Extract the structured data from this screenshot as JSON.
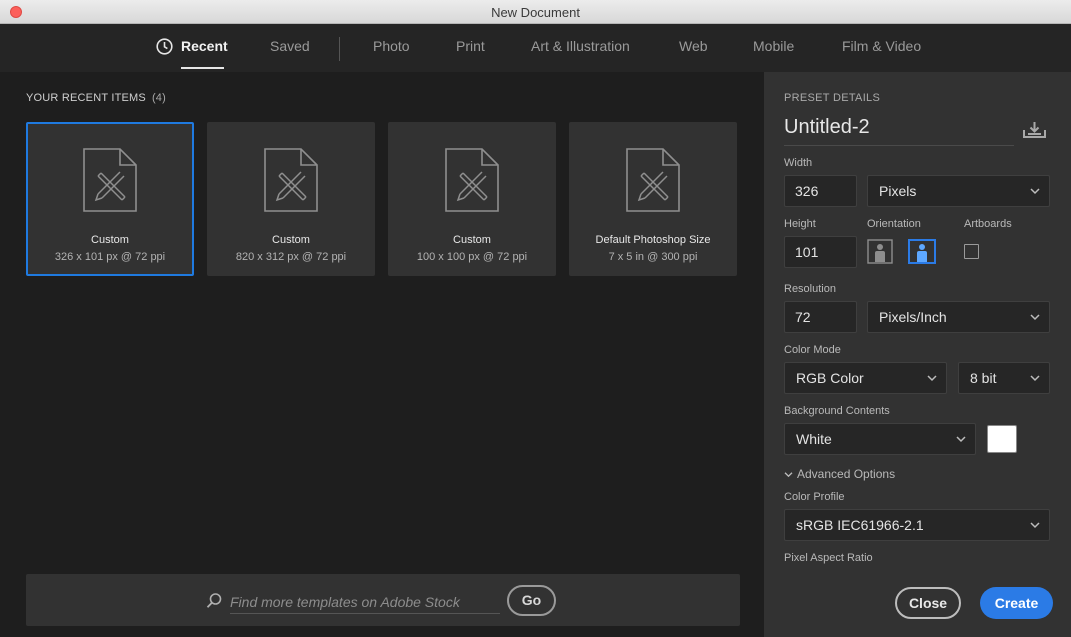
{
  "window": {
    "title": "New Document"
  },
  "tabs": [
    {
      "label": "Recent",
      "active": true
    },
    {
      "label": "Saved"
    },
    {
      "label": "Photo"
    },
    {
      "label": "Print"
    },
    {
      "label": "Art & Illustration"
    },
    {
      "label": "Web"
    },
    {
      "label": "Mobile"
    },
    {
      "label": "Film & Video"
    }
  ],
  "recent": {
    "heading": "YOUR RECENT ITEMS",
    "count": "(4)",
    "items": [
      {
        "name": "Custom",
        "dims": "326 x 101 px @ 72 ppi",
        "selected": true
      },
      {
        "name": "Custom",
        "dims": "820 x 312 px @ 72 ppi"
      },
      {
        "name": "Custom",
        "dims": "100 x 100 px @ 72 ppi"
      },
      {
        "name": "Default Photoshop Size",
        "dims": "7 x 5 in @ 300 ppi"
      }
    ]
  },
  "search": {
    "placeholder": "Find more templates on Adobe Stock",
    "go_label": "Go"
  },
  "preset": {
    "section_title": "PRESET DETAILS",
    "document_name": "Untitled-2",
    "width_label": "Width",
    "width_value": "326",
    "width_unit": "Pixels",
    "height_label": "Height",
    "height_value": "101",
    "orientation_label": "Orientation",
    "orientation_selected": "landscape",
    "artboards_label": "Artboards",
    "artboards_checked": false,
    "resolution_label": "Resolution",
    "resolution_value": "72",
    "resolution_unit": "Pixels/Inch",
    "color_mode_label": "Color Mode",
    "color_mode_value": "RGB Color",
    "bit_depth_value": "8 bit",
    "background_label": "Background Contents",
    "background_value": "White",
    "background_color": "#ffffff",
    "advanced_label": "Advanced Options",
    "color_profile_label": "Color Profile",
    "color_profile_value": "sRGB IEC61966-2.1",
    "pixel_aspect_label": "Pixel Aspect Ratio"
  },
  "actions": {
    "close_label": "Close",
    "create_label": "Create"
  },
  "colors": {
    "accent": "#2b7be6",
    "panel": "#323232",
    "background": "#1e1e1e"
  }
}
